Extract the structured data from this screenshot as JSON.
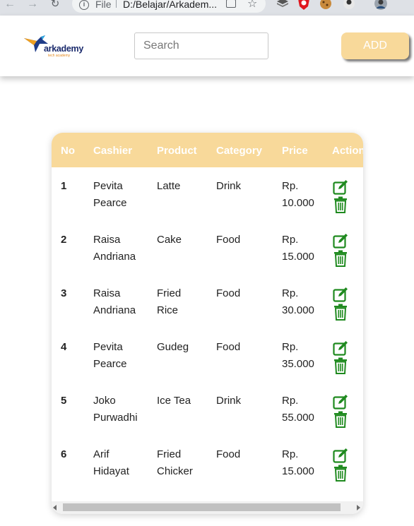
{
  "browser": {
    "scheme": "File",
    "url": "D:/Belajar/Arkadem..."
  },
  "header": {
    "logo_text": "arkademy",
    "logo_tagline": "tech academy",
    "search_placeholder": "Search",
    "add_label": "ADD"
  },
  "table": {
    "columns": [
      "No",
      "Cashier",
      "Product",
      "Category",
      "Price",
      "Action"
    ],
    "rows": [
      {
        "no": "1",
        "cashier": [
          "Pevita",
          "Pearce"
        ],
        "product": [
          "Latte"
        ],
        "category": "Drink",
        "price": [
          "Rp.",
          "10.000"
        ]
      },
      {
        "no": "2",
        "cashier": [
          "Raisa",
          "Andriana"
        ],
        "product": [
          "Cake"
        ],
        "category": "Food",
        "price": [
          "Rp.",
          "15.000"
        ]
      },
      {
        "no": "3",
        "cashier": [
          "Raisa",
          "Andriana"
        ],
        "product": [
          "Fried",
          "Rice"
        ],
        "category": "Food",
        "price": [
          "Rp.",
          "30.000"
        ]
      },
      {
        "no": "4",
        "cashier": [
          "Pevita",
          "Pearce"
        ],
        "product": [
          "Gudeg"
        ],
        "category": "Food",
        "price": [
          "Rp.",
          "35.000"
        ]
      },
      {
        "no": "5",
        "cashier": [
          "Joko",
          "Purwadhi"
        ],
        "product": [
          "Ice Tea"
        ],
        "category": "Drink",
        "price": [
          "Rp.",
          "55.000"
        ]
      },
      {
        "no": "6",
        "cashier": [
          "Arif",
          "Hidayat"
        ],
        "product": [
          "Fried",
          "Chicker"
        ],
        "category": "Food",
        "price": [
          "Rp.",
          "15.000"
        ]
      }
    ]
  },
  "colors": {
    "accent": "#f8d99a",
    "action_icon": "#1f8a1f",
    "header_text": "#ffffff"
  },
  "icons": {
    "edit": "edit-icon",
    "delete": "trash-icon"
  }
}
